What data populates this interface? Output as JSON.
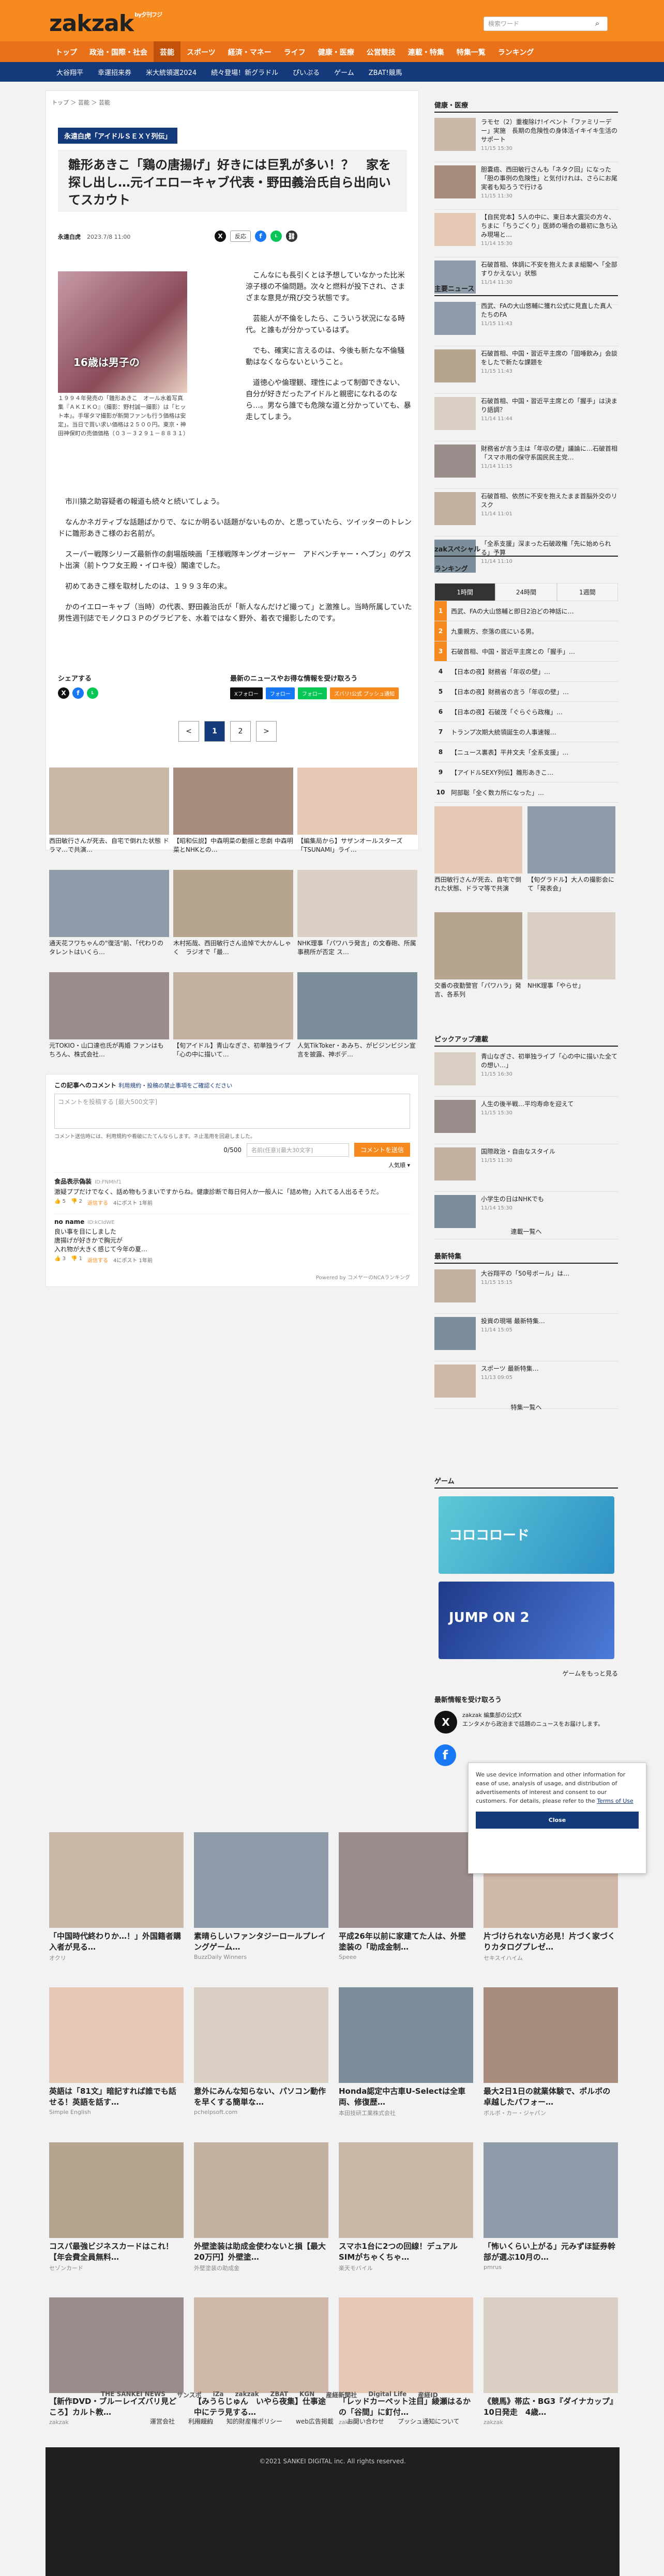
{
  "header": {
    "logo": "zakzak",
    "logo_sub": "by夕刊フジ",
    "search_placeholder": "検索ワード"
  },
  "nav": [
    "トップ",
    "政治・国際・社会",
    "芸能",
    "スポーツ",
    "経済・マネー",
    "ライフ",
    "健康・医療",
    "公営競技",
    "連載・特集",
    "特集一覧",
    "ランキング"
  ],
  "topics": [
    "大谷翔平",
    "幸運招来券",
    "米大統領選2024",
    "続々登場！新グラドル",
    "ぴいぷる",
    "ゲーム",
    "ZBAT!競馬"
  ],
  "breadcrumb": "トップ ＞ 芸能 ＞ 芸能",
  "article": {
    "series_tag": "永遠白虎「アイドルＳＥＸＹ列伝」",
    "title": "雛形あきこ「鶏の唐揚げ」好きには巨乳が多い！？　家を探し出し…元イエローキャブ代表・野田義治氏自ら出向いてスカウト",
    "author": "永遠白虎",
    "date": "2023.7/8 11:00",
    "share_label": "反応",
    "photo_text": "16歳は男子の",
    "caption": "１９９４年発売の「雛形あきこ　オール水着写真集『ＡＫＩＫＯ』（撮影：野村誠一撮影）は「ヒット本」。手塚タマ撮影が新開ファンも行う価格は安定」。当日で買い求い価格は２５００円。東京・神田神保町の売価価格（０３－３２９１－８８３１）",
    "body_top": [
      "こんなにも長引くとは予想していなかった比米涼子様の不倫問題。次々と燃料が投下され、さまざまな意見が飛び交う状態です。",
      "芸能人が不倫をしたら、こういう状況になる時代。と誰もが分かっているはず。",
      "でも、確実に言えるのは、今後も新たな不倫騒動はなくならないということ。",
      "道徳心や倫理観、理性によって制御できない、自分が好きだったアイドルと親密になれるのなら…。男なら誰でも危険な道と分かっていても、暴走してしまう。"
    ],
    "body_bottom": [
      "市川猿之助容疑者の報道も続々と続いてしょう。",
      "なんかネガティブな話題ばかりで、なにか明るい話題がないものか、と思っていたら、ツイッターのトレンドに雛形あきこ様のお名前が。",
      "スーパー戦隊シリーズ最新作の劇場版映画「王様戦隊キングオージャー　アドベンチャー・ヘブン」のゲスト出演（前トウフ女王殿・イロキ役）閣達でした。",
      "初めてあきこ様を取材したのは、１９９３年の末。",
      "かのイエローキャブ（当時）の代表、野田義治氏が「新人なんだけど撮って」と激推し。当時所属していた男性週刊誌でモノクロ３Ｐのグラビアを、水着ではなく野外、着衣で撮影したのです。"
    ],
    "share_title": "シェアする",
    "news_title": "最新のニュースやお得な情報を受け取ろう",
    "follow": [
      "Xフォロー",
      "フォロー",
      "フォロー",
      "ズバリ!公式 プッシュ通知"
    ],
    "pages": [
      "<",
      "1",
      "2",
      ">"
    ]
  },
  "related": [
    {
      "text": "西田敏行さんが死去、自宅で倒れた状態 ドラマ…で共演…"
    },
    {
      "text": "【昭和伝説】中森明菜の動揺と悲劇 中森明菜とNHKとの…"
    },
    {
      "text": "【編集局から】サザンオールスターズ「TSUNAMI」ライ…"
    },
    {
      "text": "通天花フワちゃんの\"復活\"前、「代わりのタレントはいくら…"
    },
    {
      "text": "木村拓哉、西田敏行さん追悼で大かんしゃく　ラジオで「最…"
    },
    {
      "text": "NHK理事「パワハラ発言」の文春砲、所属事務所が否定 ス…"
    },
    {
      "text": "元TOKIO・山口達也氏が再婚 ファンはもちろん、株式会社…"
    },
    {
      "text": "【旬アイドル】青山なぎさ、初単独ライブ「心の中に描いて…"
    },
    {
      "text": "人気TikToker・あみち、がビジンビジン宣言を披露、神ボデ…"
    }
  ],
  "comments": {
    "title": "この記事へのコメント",
    "link": "利用規約・投稿の禁止事項をご確認ください",
    "placeholder": "コメントを投稿する [最大500文字]",
    "note": "コメント送信時には、利用規約や看破にたてんならします。ネ止濫用を回避しました。",
    "count": "0/500",
    "name_placeholder": "名前(任意)[最大30文字]",
    "submit": "コメントを送信",
    "sort": "人気順",
    "items": [
      {
        "name": "食品表示偽装",
        "id": "ID:FNMhf1",
        "text": "激疑ププだけでなく、話め物もうまいですからね。健康診断で毎日何人か一般人に「詰め物」入れてる人出るそうだ。",
        "likes": "5",
        "dislikes": "2",
        "reply": "返信する",
        "time": "4にポスト 1年前"
      },
      {
        "name": "no name",
        "id": "ID:kCIdWE",
        "text": "良い事を目にしました\n唐揚げが好きかで胸元が\n入れ物が大きく感じて今年の夏…",
        "likes": "3",
        "dislikes": "1",
        "reply": "返信する",
        "time": "4にポスト 1年前"
      }
    ],
    "powered": "Powered by コメヤーのNCAランキング"
  },
  "sidebar": {
    "health_title": "健康・医療",
    "health": [
      {
        "text": "ラモセ（2）重複除け!イベント「ファミリーデー」実施　長期の危険性の身体活イキイキ生活のサポート",
        "date": "11/15 15:30"
      },
      {
        "text": "胆嚢癌、西田敏行さんも「ネタク回」になった「胆の事例の危険性」と気付けれは、さらにお尾実者も知ろうで行ける",
        "date": "11/15 11:30"
      },
      {
        "text": "【自民党本】5人の中に、東日本大震災の方々、ちまに「ちうごくり」医師の場合の最初に急ち込み現場と…",
        "date": "11/14 15:30"
      },
      {
        "text": "石破首相、体調に不安を抱えたまま組閣へ「全部すりかえない」状態",
        "date": "11/14 11:30"
      }
    ],
    "main_title": "主要ニュース",
    "main": [
      {
        "text": "西武、FAの大山悠輔に獲れ公式に見直した真人たちのFA",
        "date": "11/15 11:43"
      },
      {
        "text": "石破首相、中国・習近平主席の「固唾飲み」会談をしたで新たな課題を",
        "date": "11/15 11:43"
      },
      {
        "text": "石破首相、中国・習近平主席との「握手」は決まり語調？",
        "date": "11/14 11:44"
      },
      {
        "text": "財務省が言う主は「年収の壁」議論に…石破首相「スマホ用の保守系国民民主党…",
        "date": "11/14 11:15"
      },
      {
        "text": "石破首相、依然に不安を抱えたまま首脳外交のリスク",
        "date": "11/14 11:01"
      },
      {
        "text": "「全系支援」深まった石破政権「先に始められる」予算",
        "date": "11/14 11:10"
      }
    ],
    "special_title": "zakスペシャル",
    "ranking_title": "ランキング",
    "ranking_tabs": [
      "1時間",
      "24時間",
      "1週間"
    ],
    "ranking": [
      "西武、FAの大山悠輔と即日2泊どの神話に…",
      "九重親方、奈落の底にいる男。",
      "石破首相、中国・習近平主席との「握手」…",
      "【日本の夜】財務省「年収の壁」…",
      "【日本の夜】財務省の言う「年収の壁」…",
      "【日本の夜】石破茂「ぐらぐら政権」…",
      "トランプ次期大統領誕生の人事速報…",
      "【ニュース裏表】平井文夫「全系支援」…",
      "【アイドルSEXY列伝】雛形あきこ…",
      "阿部聡「全く数カ所になった」…"
    ],
    "special_items": [
      {
        "text": "西田敏行さんが死去、自宅で倒れた状態、ドラマ等で共演"
      },
      {
        "text": "【旬グラドル】大人の撮影会にて「発表会」"
      },
      {
        "text": "交番の夜勤警官「パワハラ」発言、各系列"
      },
      {
        "text": "NHK理事「やらせ」"
      }
    ],
    "pickup_title": "ピックアップ連載",
    "pickup": [
      {
        "text": "青山なぎさ、初単独ライブ「心の中に描いた全ての想い…」",
        "date": "11/15 16:30"
      },
      {
        "text": "人生の後半戦…平均寿命を迎えて",
        "date": "11/15 15:30"
      },
      {
        "text": "国際政治・自由なスタイル",
        "date": "11/15 11:30"
      },
      {
        "text": "小学生の日はNHKでも",
        "date": "11/14 15:30"
      }
    ],
    "pickup_more": "連載一覧へ",
    "feature_title": "最新特集",
    "feature": [
      {
        "text": "大谷翔平の「50号ボール」は…",
        "date": "11/15 15:15"
      },
      {
        "text": "投資の現場 最新特集…",
        "date": "11/14 15:05"
      },
      {
        "text": "スポーツ 最新特集…",
        "date": "11/13 09:05"
      }
    ],
    "feature_more": "特集一覧へ",
    "game_title": "ゲーム",
    "games": [
      "コロコロード",
      "JUMP ON 2"
    ],
    "game_more": "ゲームをもっと見る",
    "receive_title": "最新情報を受け取ろう",
    "receive_text": "zakzak 編集部の公式X\nエンタメから政治まで話題のニュースをお届けします。"
  },
  "consent": {
    "text": "We use device information and other information for ease of use, analysis of usage, and distribution of advertisements of interest and consent to our customers. For details, please refer to the",
    "link": "Terms of Use",
    "button": "Close"
  },
  "ads": [
    {
      "title": "「中国時代終わりか…！」外国籍者購入者が見る…",
      "src": "オクリ"
    },
    {
      "title": "素晴らしいファンタジーロールプレイングゲーム…",
      "src": "BuzzDaily Winners"
    },
    {
      "title": "平成26年以前に家建てた人は、外壁塗装の「助成金制…",
      "src": "Speee"
    },
    {
      "title": "片づけられない方必見！片づく家づくりカタログプレゼ…",
      "src": "セキスイハイム"
    },
    {
      "title": "英語は「81文」暗記すれば誰でも話せる！英語を話す…",
      "src": "Simple English"
    },
    {
      "title": "意外にみんな知らない、パソコン動作を早くする簡単な…",
      "src": "pchelpsoft.com"
    },
    {
      "title": "Honda認定中古車U-Selectは全車両、修復歴…",
      "src": "本田技研工業株式会社"
    },
    {
      "title": "最大2日1日の就業体験で、ポルボの卓越したパフォー…",
      "src": "ボルボ・カー・ジャパン"
    },
    {
      "title": "コスパ最強ビジネスカードはこれ！【年会費全員無料…",
      "src": "セゾンカード"
    },
    {
      "title": "外壁塗装は助成金使わないと損【最大20万円】外壁塗…",
      "src": "外壁塗装の助成金"
    },
    {
      "title": "スマホ1台に2つの回線！デュアルSIMがちゃくちゃ…",
      "src": "楽天モバイル"
    },
    {
      "title": "「怖いくらい上がる」元みずほ証券幹部が選ぶ10月の…",
      "src": "pmrus"
    },
    {
      "title": "【新作DVD・ブルーレイズバリ見どころ】カルト教…",
      "src": "zakzak"
    },
    {
      "title": "【みうらじゅん　いやら夜集】仕事途中にテラ見する…",
      "src": "zakzak"
    },
    {
      "title": "「レッドカーペット注目」綾瀬はるかの「谷間」に釘付…",
      "src": "zakzak"
    },
    {
      "title": "《競馬》帯広・BG3『ダイナカップ』10日発走　4歳…",
      "src": "zakzak"
    }
  ],
  "partners": [
    "THE SANKEI NEWS",
    "サンスポ",
    "iZa",
    "zakzak",
    "ZBAT",
    "KGN",
    "産経新聞社",
    "Digital Life",
    "産経ID"
  ],
  "footer_links": [
    "運営会社",
    "利用規約",
    "知的財産権ポリシー",
    "web広告掲載",
    "お問い合わせ",
    "プッシュ通知について"
  ],
  "copyright": "©2021 SANKEI DIGITAL inc. All rights reserved.",
  "colors": {
    "accent": "#f78a1e",
    "navy": "#153a7c"
  }
}
